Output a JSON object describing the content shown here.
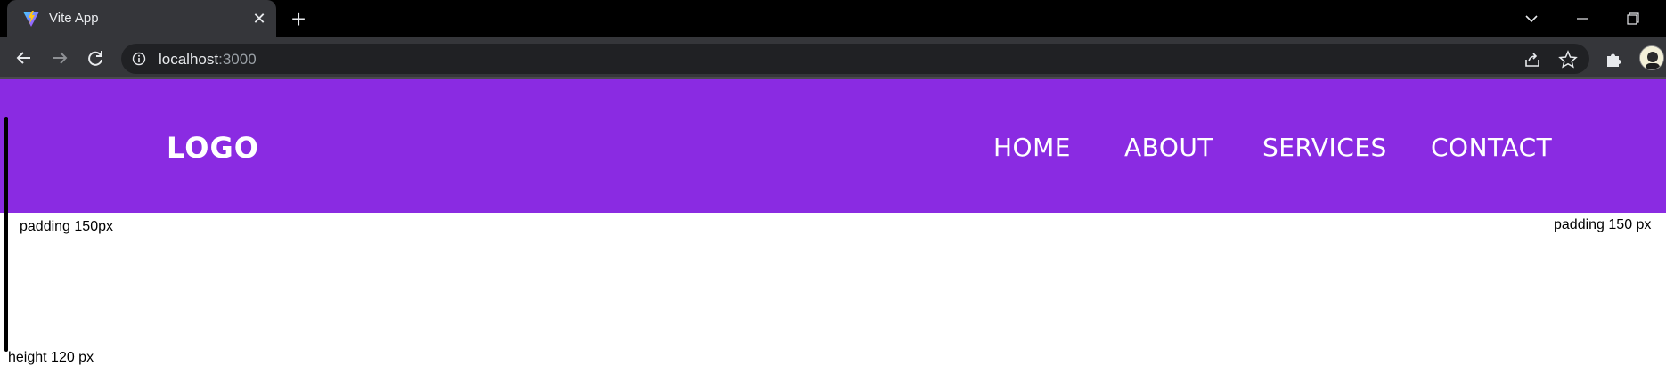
{
  "browser": {
    "tab_title": "Vite App",
    "tab_close": "✕",
    "new_tab": "+",
    "url_host": "localhost",
    "url_port": ":3000"
  },
  "site": {
    "logo": "LOGO",
    "nav": [
      "HOME",
      "ABOUT",
      "SERVICES",
      "CONTACT"
    ],
    "colors": {
      "header_bg": "#8a2be2",
      "header_text": "#ffffff"
    }
  },
  "annotations": {
    "padding_left": "padding 150px",
    "padding_right": "padding 150 px",
    "height": "height 120 px"
  }
}
